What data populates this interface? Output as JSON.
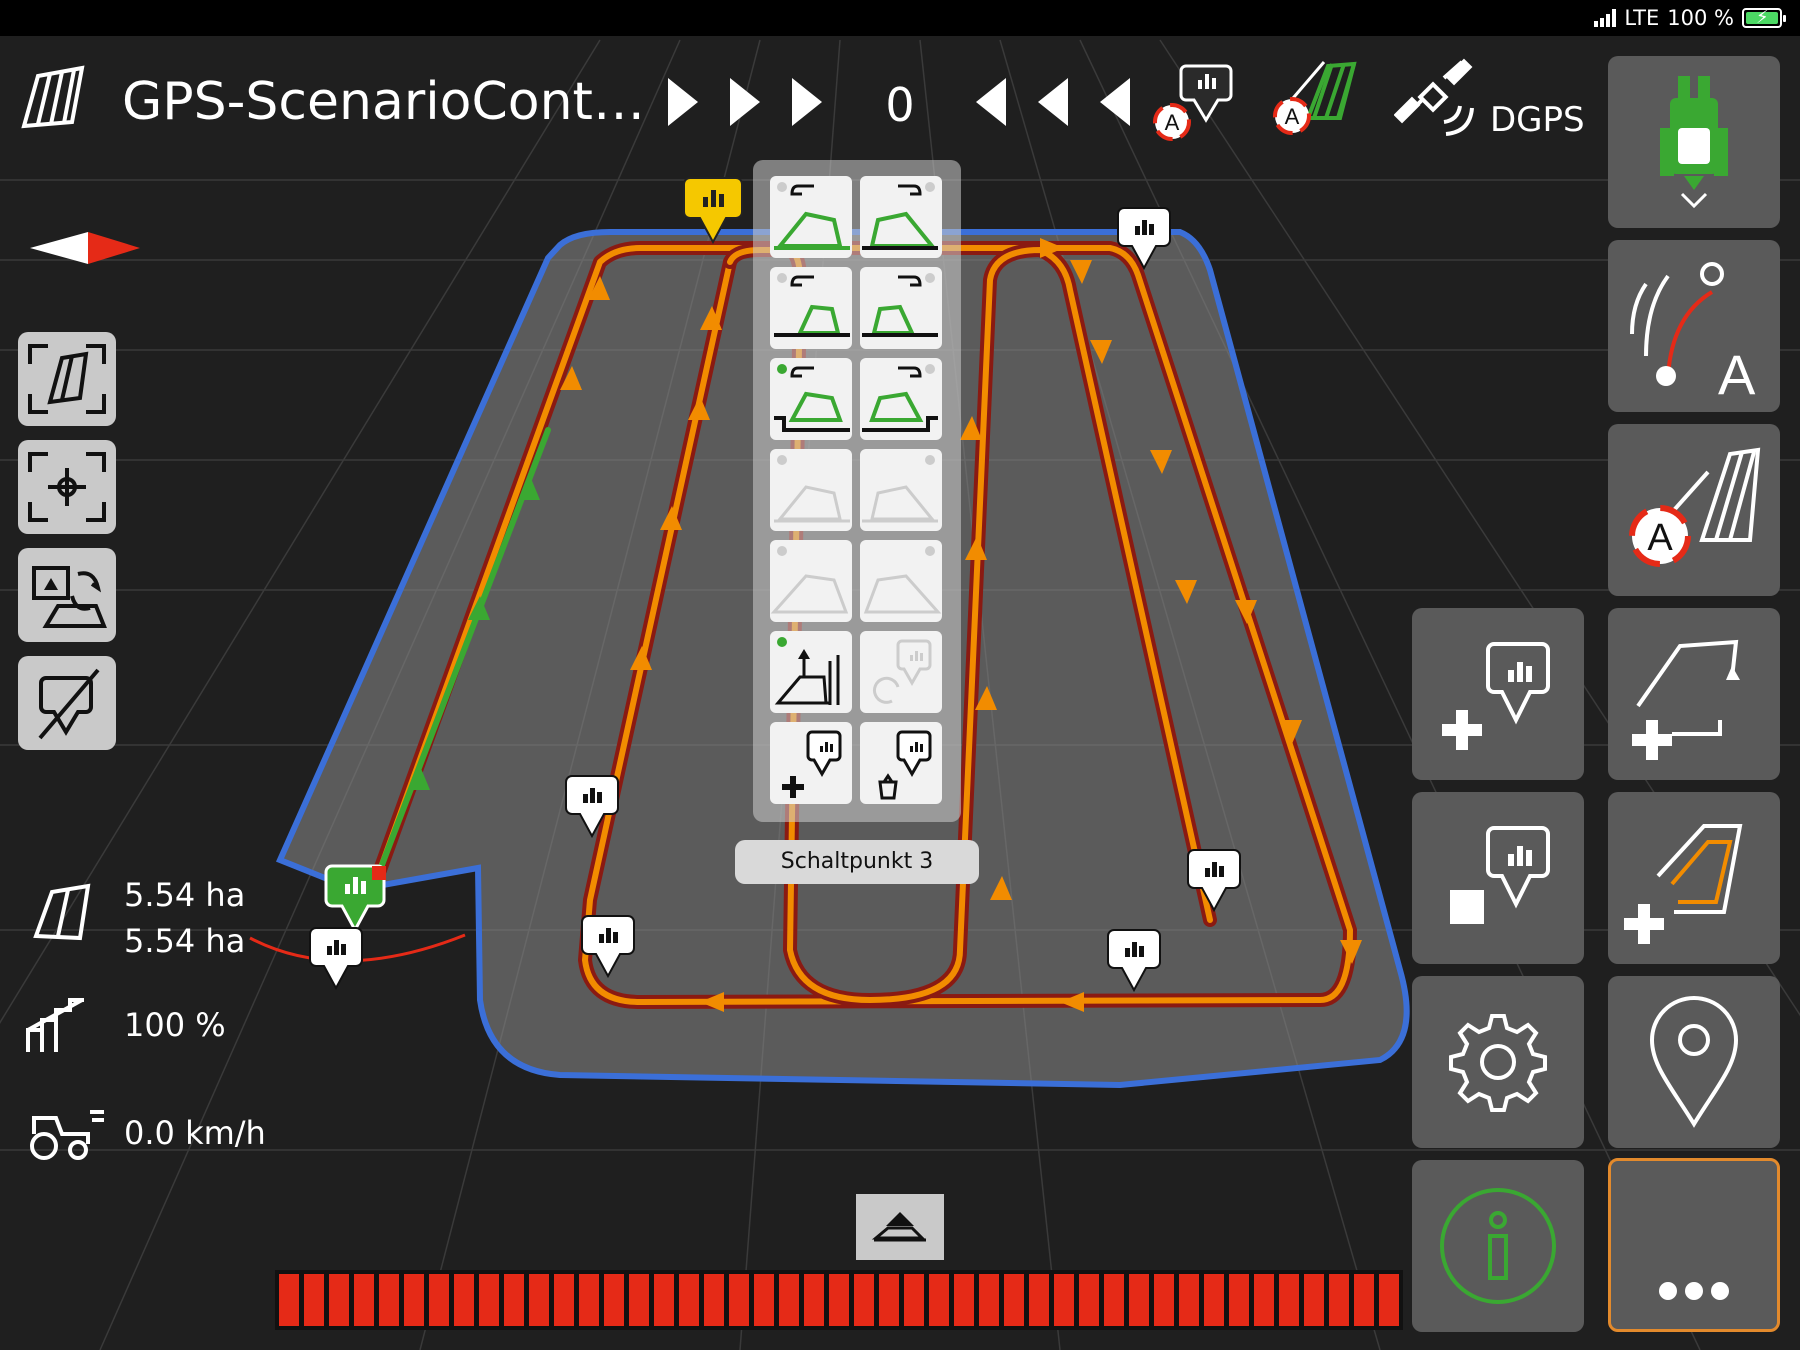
{
  "status": {
    "network": "LTE",
    "battery": "100 %",
    "battery_color": "#4cd964"
  },
  "header": {
    "title": "GPS-ScenarioCont…",
    "counter": "0",
    "gps_mode": "DGPS"
  },
  "info": {
    "area_total": "5.54 ha",
    "area_worked": "5.54 ha",
    "rate": "100 %",
    "speed": "0.0 km/h"
  },
  "popup": {
    "tooltip": "Schaltpunkt 3"
  },
  "colors": {
    "accent_orange": "#f28c00",
    "track_green": "#3aa832",
    "field_blue": "#3b6fd8",
    "section_red": "#e52a17",
    "marker_yellow": "#f5c800"
  },
  "sections": {
    "count": 45
  }
}
